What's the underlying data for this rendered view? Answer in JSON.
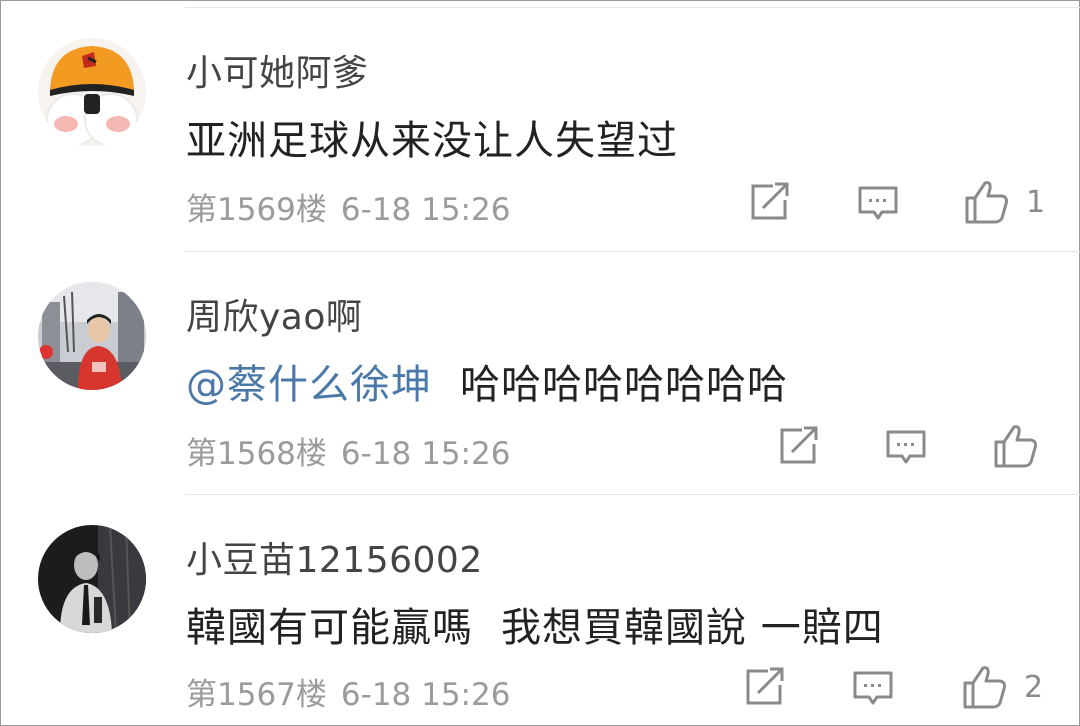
{
  "comments": [
    {
      "username": "小可她阿爹",
      "text": "亚洲足球从来没让人失望过",
      "floor": "第1569楼",
      "time": "6-18 15:26",
      "likes": "1"
    },
    {
      "username": "周欣yao啊",
      "mention": "@蔡什么徐坤",
      "text": "哈哈哈哈哈哈哈哈",
      "floor": "第1568楼",
      "time": "6-18 15:26",
      "likes": ""
    },
    {
      "username": "小豆苗12156002",
      "text_part1": "韓國有可能贏嗎",
      "text_part2": "我想買韓國說 一賠四",
      "floor": "第1567楼",
      "time": "6-18 15:26",
      "likes": "2"
    }
  ],
  "icons": {
    "share": "share-icon",
    "reply": "comment-icon",
    "like": "thumbs-up-icon"
  },
  "colors": {
    "mention": "#4a78a8",
    "meta": "#9b9b9b",
    "icon": "#8a8a8a"
  }
}
